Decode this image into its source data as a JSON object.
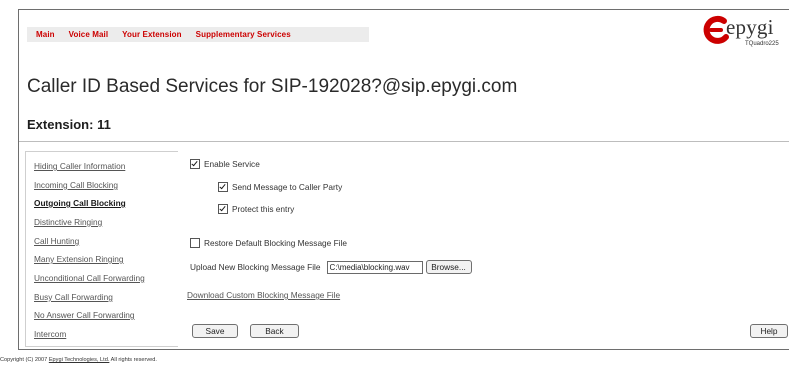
{
  "topnav": {
    "items": [
      "Main",
      "Voice Mail",
      "Your Extension",
      "Supplementary Services"
    ]
  },
  "brand": {
    "logo_text": "epygi",
    "model": "TQuadro225",
    "accent": "#cc0000"
  },
  "page": {
    "title": "Caller ID Based Services for SIP-192028?@sip.epygi.com",
    "extension": "Extension: 11"
  },
  "sidebar": {
    "items": [
      {
        "label": "Hiding Caller Information"
      },
      {
        "label": "Incoming Call Blocking"
      },
      {
        "label": "Outgoing Call Blocking",
        "active": true
      },
      {
        "label": "Distinctive Ringing"
      },
      {
        "label": "Call Hunting"
      },
      {
        "label": "Many Extension Ringing"
      },
      {
        "label": "Unconditional Call Forwarding"
      },
      {
        "label": "Busy Call Forwarding"
      },
      {
        "label": "No Answer Call Forwarding"
      },
      {
        "label": "Intercom"
      }
    ]
  },
  "form": {
    "enable_service": {
      "label": "Enable Service",
      "checked": true
    },
    "send_message": {
      "label": "Send Message to Caller Party",
      "checked": true
    },
    "protect_entry": {
      "label": "Protect this entry",
      "checked": true
    },
    "restore_default": {
      "label": "Restore Default Blocking Message File",
      "checked": false
    },
    "upload_label": "Upload New Blocking Message File",
    "upload_value": "C:\\media\\blocking.wav",
    "browse_label": "Browse...",
    "download_link": "Download Custom Blocking Message File"
  },
  "buttons": {
    "save": "Save",
    "back": "Back",
    "help": "Help"
  },
  "footer": {
    "prefix": "Copyright (C) 2007",
    "company": "Epygi Technologies, Ltd.",
    "suffix": "All rights reserved."
  }
}
